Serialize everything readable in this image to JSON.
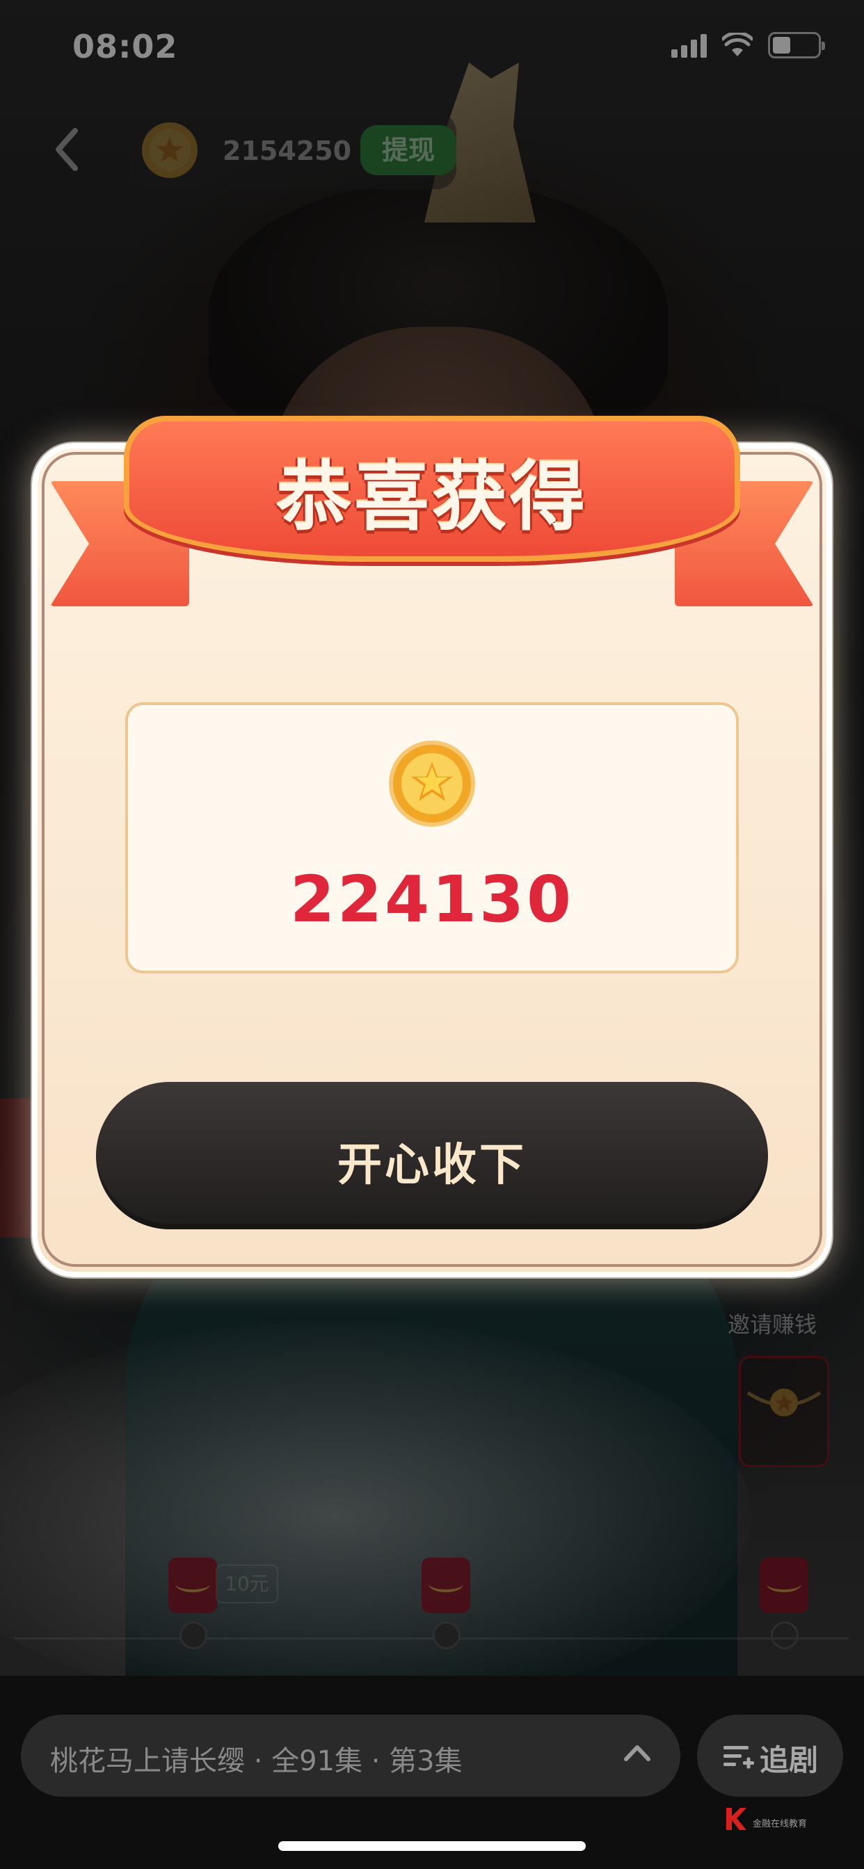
{
  "status_bar": {
    "time": "08:02"
  },
  "top_bar": {
    "coin_balance": "2154250",
    "withdraw_label": "提现"
  },
  "side": {
    "invite_label": "邀请赚钱"
  },
  "timeline": {
    "reward_tag": "10元"
  },
  "modal": {
    "title": "恭喜获得",
    "reward_amount": "224130",
    "accept_label": "开心收下"
  },
  "bottom_bar": {
    "series_info": "桃花马上请长缨 · 全91集 · 第3集",
    "follow_label": "追剧",
    "watermark": "金融在线教育"
  },
  "colors": {
    "ribbon": "#ee4a37",
    "reward_amount": "#e0263a",
    "accept_button": "#1f1c1c",
    "withdraw_button": "#2e7d3a"
  },
  "icons": [
    "back-arrow-icon",
    "coin-star-icon",
    "signal-icon",
    "wifi-icon",
    "battery-icon",
    "chevron-up-icon",
    "follow-list-icon",
    "red-packet-icon"
  ]
}
